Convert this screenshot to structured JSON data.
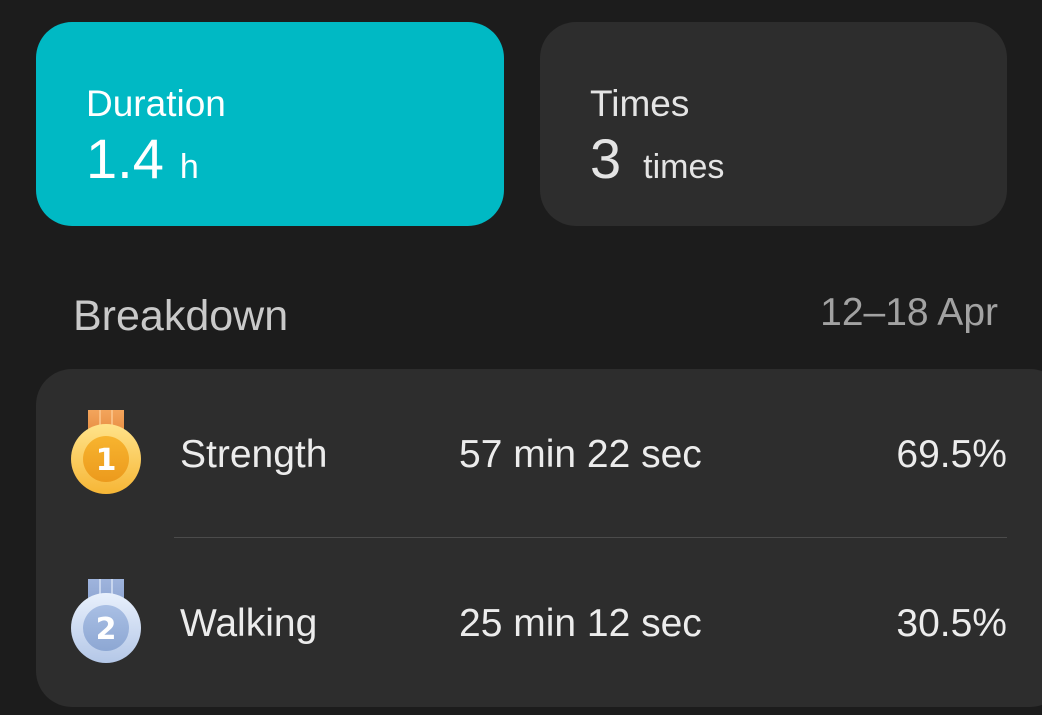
{
  "summary": {
    "duration": {
      "label": "Duration",
      "value": "1.4",
      "unit": "h",
      "color": "#00b9c4"
    },
    "times": {
      "label": "Times",
      "value": "3",
      "unit": "times"
    }
  },
  "breakdown": {
    "title": "Breakdown",
    "date_range": "12–18 Apr",
    "items": [
      {
        "rank": "1",
        "medal": "gold-medal-icon",
        "name": "Strength",
        "duration": "57 min 22 sec",
        "percent": "69.5%"
      },
      {
        "rank": "2",
        "medal": "silver-medal-icon",
        "name": "Walking",
        "duration": "25 min 12 sec",
        "percent": "30.5%"
      }
    ]
  }
}
